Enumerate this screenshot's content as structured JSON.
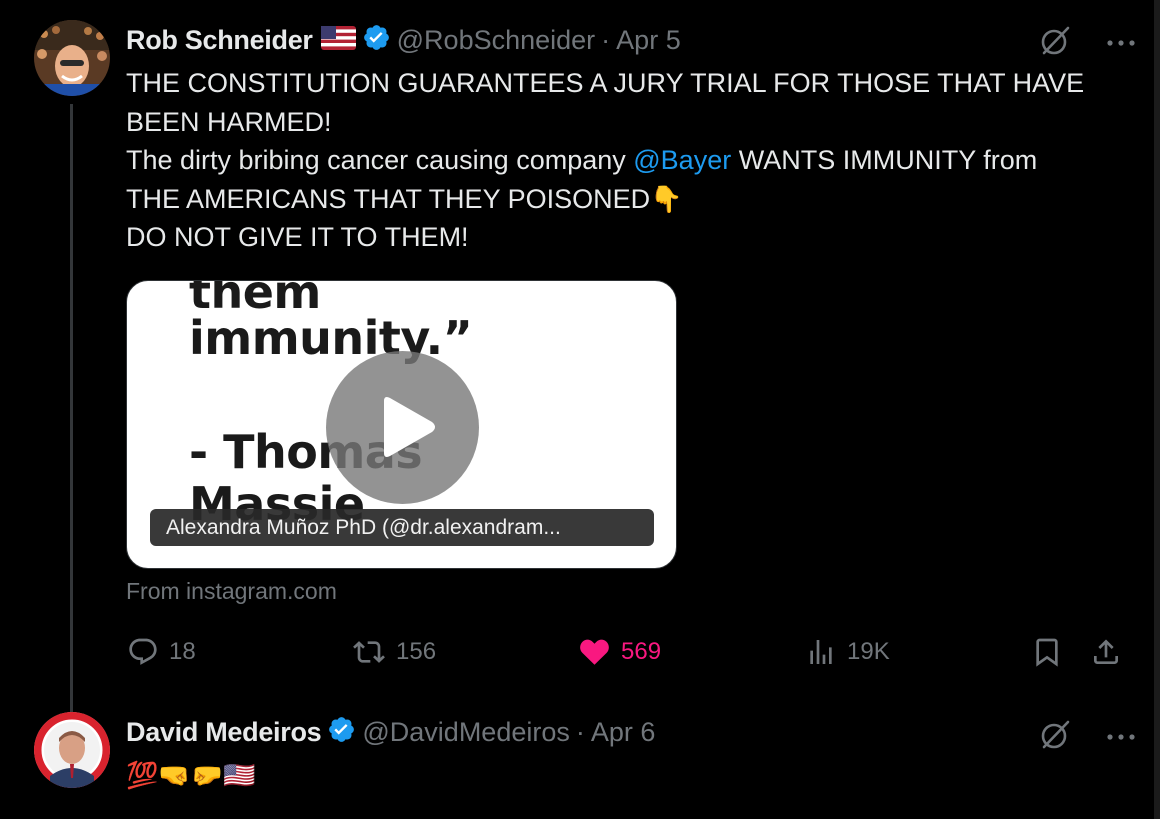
{
  "tweet1": {
    "author_name": "Rob Schneider",
    "flag_emoji": "🇺🇸",
    "handle": "@RobSchneider",
    "separator": "·",
    "date": "Apr 5",
    "verified": true,
    "text_lines": [
      "THE CONSTITUTION GUARANTEES A JURY TRIAL FOR THOSE THAT HAVE",
      "BEEN HARMED!"
    ],
    "line3_before": "The dirty bribing cancer causing company ",
    "mention": "@Bayer",
    "line3_after": " WANTS IMMUNITY from",
    "line4": "THE AMERICANS THAT THEY POISONED",
    "line4_emoji": "👇",
    "line5": "DO NOT GIVE IT TO THEM!",
    "media": {
      "quote_line1": "them",
      "quote_line2": "immunity.”",
      "quote_line3": "- Thomas",
      "quote_line4": "Massie",
      "caption": "Alexandra Muñoz PhD (@dr.alexandram...",
      "source": "From instagram.com"
    },
    "stats": {
      "replies": "18",
      "reposts": "156",
      "likes": "569",
      "views": "19K"
    },
    "liked": true
  },
  "tweet2": {
    "author_name": "David Medeiros",
    "handle": "@DavidMedeiros",
    "separator": "·",
    "date": "Apr 6",
    "verified": true,
    "text": "💯🤜🤛🇺🇸"
  },
  "icons": {
    "grok": "grok-icon",
    "more": "more-icon",
    "reply": "reply-icon",
    "repost": "repost-icon",
    "like": "heart-icon",
    "views": "views-icon",
    "bookmark": "bookmark-icon",
    "share": "share-icon"
  },
  "colors": {
    "background": "#000000",
    "text": "#e7e9ea",
    "muted": "#71767b",
    "link": "#1d9bf0",
    "like": "#f91880",
    "verified": "#1d9bf0"
  }
}
